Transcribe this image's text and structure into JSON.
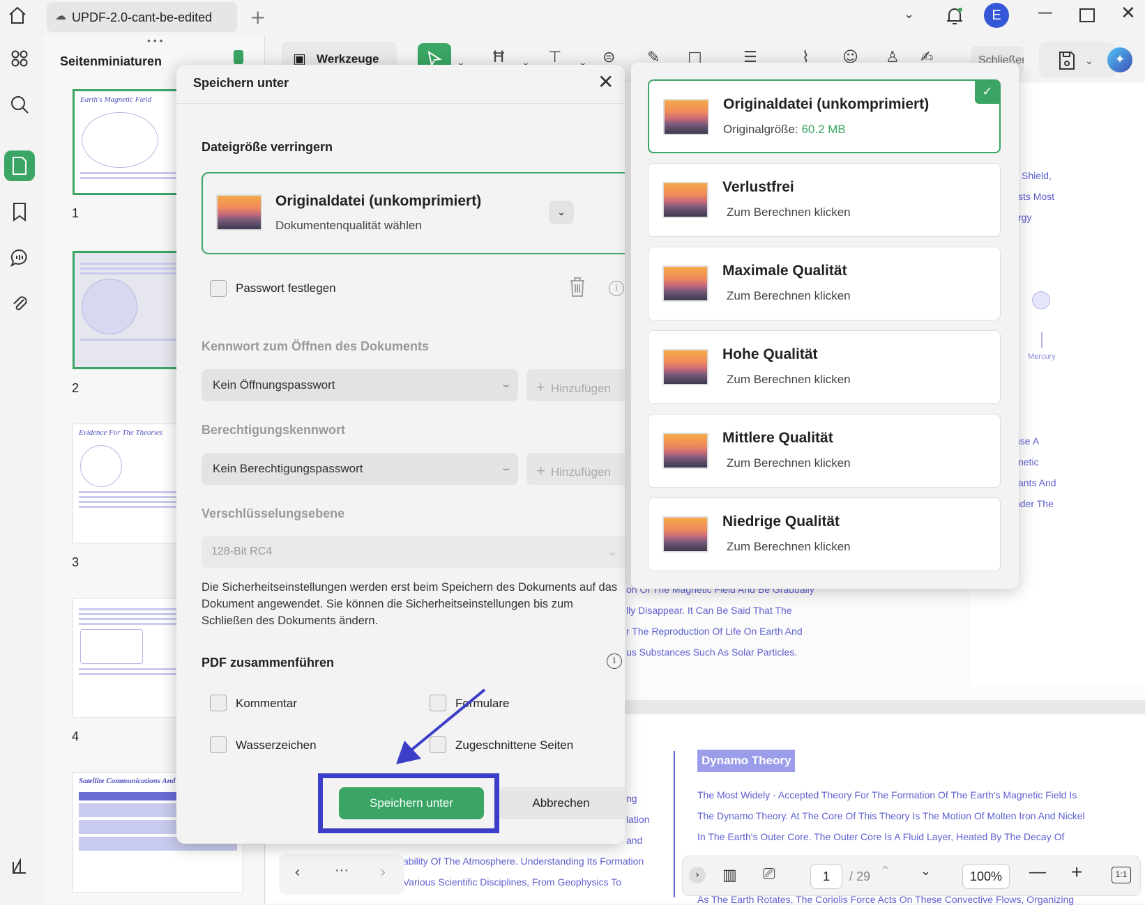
{
  "titlebar": {
    "tab_title": "UPDF-2.0-cant-be-edited",
    "avatar_letter": "E"
  },
  "thumbnails": {
    "title": "Seitenminiaturen",
    "pages": [
      {
        "num": "1",
        "heading": "Earth's Magnetic Field"
      },
      {
        "num": "2",
        "heading": ""
      },
      {
        "num": "3",
        "heading": "Evidence For The Theories"
      },
      {
        "num": "4",
        "heading": ""
      },
      {
        "num": "",
        "heading": "Satellite Communications And"
      }
    ]
  },
  "toolbar": {
    "tools_label": "Werkzeuge",
    "close_label": "Schließen"
  },
  "document": {
    "right_snippets": [
      "Shield,",
      "sts Most",
      "rgy",
      "Mercury",
      "use A",
      "netic",
      "ants And",
      "nder The"
    ],
    "mid_snippets": [
      "on Of The Magnetic Field And Be Gradually",
      "lly Disappear. It Can Be Said That The",
      "r The Reproduction Of Life On Earth And",
      "us Substances Such As Solar Particles."
    ],
    "section_title": "Dynamo Theory",
    "section_lines": [
      "The Most Widely - Accepted Theory For The Formation Of The Earth's Magnetic Field Is",
      "The Dynamo Theory. At The Core Of This Theory Is The Motion Of Molten Iron And Nickel",
      "In The Earth's Outer Core. The Outer Core Is A Fluid Layer, Heated By The Decay Of",
      "As The Earth Rotates, The Coriolis Force Acts On These Convective Flows, Organizing"
    ],
    "left_snippets": [
      "ng",
      "lation",
      "and"
    ],
    "bottom_lines": [
      "ability Of The Atmosphere. Understanding Its Formation",
      "Various Scientific Disciplines, From Geophysics To"
    ]
  },
  "bottombar": {
    "page_current": "1",
    "page_total": "/ 29",
    "zoom": "100%",
    "fit_label": "1:1"
  },
  "dialog": {
    "title": "Speichern unter",
    "reduce_section": "Dateigröße verringern",
    "selected_quality": "Originaldatei (unkomprimiert)",
    "quality_hint": "Dokumentenqualität wählen",
    "password_label": "Passwort festlegen",
    "open_pw_section": "Kennwort zum Öffnen des Dokuments",
    "open_pw_value": "Kein Öffnungspasswort",
    "add_label": "Hinzufügen",
    "perm_section": "Berechtigungskennwort",
    "perm_value": "Kein Berechtigungspasswort",
    "enc_section": "Verschlüsselungsebene",
    "enc_value": "128-Bit RC4",
    "info": "Die Sicherheitseinstellungen werden erst beim Speichern des Dokuments auf das Dokument angewendet. Sie können die Sicherheitseinstellungen bis zum Schließen des Dokuments ändern.",
    "merge_section": "PDF zusammenführen",
    "merge_options": [
      "Kommentar",
      "Formulare",
      "Wasserzeichen",
      "Zugeschnittene Seiten"
    ],
    "save_button": "Speichern unter",
    "cancel_button": "Abbrechen"
  },
  "quality_options": [
    {
      "title": "Originaldatei (unkomprimiert)",
      "size_label": "Originalgröße:",
      "size_value": "60.2 MB",
      "selected": true
    },
    {
      "title": "Verlustfrei",
      "sub": "Zum Berechnen klicken"
    },
    {
      "title": "Maximale Qualität",
      "sub": "Zum Berechnen klicken"
    },
    {
      "title": "Hohe Qualität",
      "sub": "Zum Berechnen klicken"
    },
    {
      "title": "Mittlere Qualität",
      "sub": "Zum Berechnen klicken"
    },
    {
      "title": "Niedrige Qualität",
      "sub": "Zum Berechnen klicken"
    }
  ],
  "colors": {
    "accent": "#3aa564",
    "highlight": "#3c3ec8",
    "doc_text": "#5d5fcf"
  }
}
